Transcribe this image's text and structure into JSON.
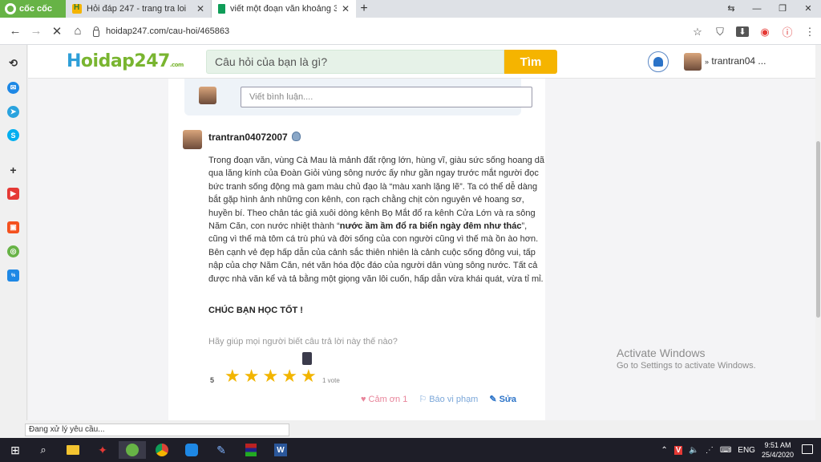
{
  "browser": {
    "brand": "cốc cốc",
    "tabs": [
      {
        "title": "Hỏi đáp 247 - trang tra loi",
        "active": false
      },
      {
        "title": "viết một đoạn văn khoảng 3 đ",
        "active": true
      }
    ],
    "url": "hoidap247.com/cau-hoi/465863"
  },
  "site": {
    "logo_h": "H",
    "logo_rest": "oidap247",
    "logo_suffix": ".com",
    "search_placeholder": "Câu hỏi của bạn là gì?",
    "search_button": "Tìm",
    "username": "trantran04 ..."
  },
  "comment": {
    "placeholder": "Viết bình luận...."
  },
  "answer": {
    "author": "trantran04072007",
    "text_part1": "Trong đoạn văn, vùng Cà Mau là mảnh đất rộng lớn, hùng vĩ, giàu sức sống hoang dã qua lăng kính của Đoàn Giỏi vùng sông nước ấy như gần ngay trước mắt người đọc bức tranh sống động mà gam màu chủ đạo là “màu xanh lặng lẽ”. Ta có thể dễ dàng bắt gặp hình ảnh những con kênh, con rạch chằng chịt còn nguyên vẻ hoang sơ, huyền bí. Theo chân tác giả xuôi dòng kênh Bọ Mắt đổ ra kênh Cửa Lớn và ra sông Năm Căn, con nước nhiệt thành “",
    "text_bold": "nước ầm ầm đổ ra biển ngày đêm như thác",
    "text_part2": "”, cũng vì thế mà tôm cá trù phú và đời sống của con người cũng vì thế mà ồn ào hơn. Bên cạnh vẻ đẹp hấp dẫn của cảnh sắc thiên nhiên là cảnh cuộc sống đông vui, tấp nập của chợ Năm Căn, nét văn hóa độc đáo của người dân vùng sông nước. Tất cả được nhà văn kể và tả bằng một giọng văn lôi cuốn, hấp dẫn vừa khái quát, vừa tỉ mỉ.",
    "closing": "CHÚC BẠN HỌC TỐT !",
    "ask_rating": "Hãy giúp mọi người biết câu trả lời này thế nào?",
    "rating": "5",
    "rating_value": 5,
    "votes": "1 vote",
    "actions": {
      "thanks": "Cảm ơn 1",
      "report": "Báo vi phạm",
      "edit": "Sửa"
    }
  },
  "status_text": "Đang xử lý yêu cầu...",
  "watermark": {
    "line1": "Activate Windows",
    "line2": "Go to Settings to activate Windows."
  },
  "taskbar": {
    "lang": "ENG",
    "time": "9:51 AM",
    "date": "25/4/2020"
  }
}
